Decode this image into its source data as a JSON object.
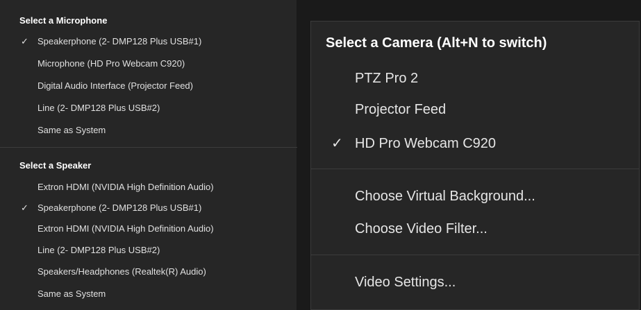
{
  "microphone": {
    "title": "Select a Microphone",
    "items": [
      {
        "label": "Speakerphone (2- DMP128 Plus USB#1)",
        "checked": true
      },
      {
        "label": "Microphone (HD Pro Webcam C920)",
        "checked": false
      },
      {
        "label": "Digital Audio Interface (Projector Feed)",
        "checked": false
      },
      {
        "label": "Line (2- DMP128 Plus USB#2)",
        "checked": false
      },
      {
        "label": "Same as System",
        "checked": false
      }
    ]
  },
  "speaker": {
    "title": "Select a Speaker",
    "items": [
      {
        "label": "Extron HDMI (NVIDIA High Definition Audio)",
        "checked": false
      },
      {
        "label": "Speakerphone (2- DMP128 Plus USB#1)",
        "checked": true
      },
      {
        "label": "Extron HDMI (NVIDIA High Definition Audio)",
        "checked": false
      },
      {
        "label": "Line (2- DMP128 Plus USB#2)",
        "checked": false
      },
      {
        "label": "Speakers/Headphones (Realtek(R) Audio)",
        "checked": false
      },
      {
        "label": "Same as System",
        "checked": false
      }
    ]
  },
  "camera": {
    "title": "Select a Camera (Alt+N to switch)",
    "items": [
      {
        "label": "PTZ Pro 2",
        "checked": false
      },
      {
        "label": "Projector Feed",
        "checked": false
      },
      {
        "label": "HD Pro Webcam C920",
        "checked": true
      }
    ],
    "actions": [
      {
        "label": "Choose Virtual Background..."
      },
      {
        "label": "Choose Video Filter..."
      }
    ],
    "settings": {
      "label": "Video Settings..."
    }
  },
  "check_mark": "✓",
  "colors": {
    "menu_bg": "#262626",
    "divider": "#3c3c3c",
    "text": "#e6e6e6"
  }
}
